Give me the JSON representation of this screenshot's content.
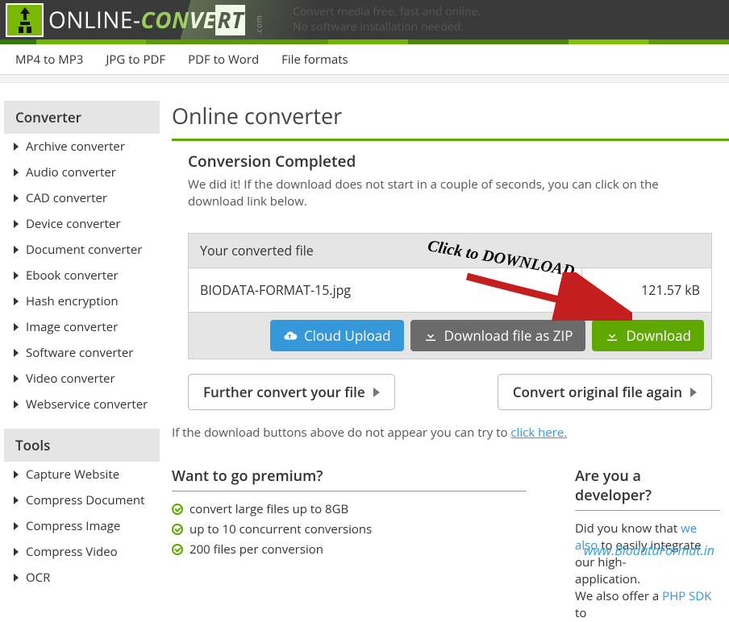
{
  "header": {
    "logo_online": "ONLINE",
    "logo_dash": "-",
    "logo_con": "CON",
    "logo_ve": "VE",
    "logo_rt": "RT",
    "logo_com": ".com",
    "tagline1": "Convert media free, fast and online.",
    "tagline2": "No software installation needed."
  },
  "topnav": {
    "items": [
      "MP4 to MP3",
      "JPG to PDF",
      "PDF to Word",
      "File formats"
    ]
  },
  "sidebar": {
    "converter_head": "Converter",
    "converter_items": [
      "Archive converter",
      "Audio converter",
      "CAD converter",
      "Device converter",
      "Document converter",
      "Ebook converter",
      "Hash encryption",
      "Image converter",
      "Software converter",
      "Video converter",
      "Webservice converter"
    ],
    "tools_head": "Tools",
    "tools_items": [
      "Capture Website",
      "Compress Document",
      "Compress Image",
      "Compress Video",
      "OCR"
    ]
  },
  "main": {
    "title": "Online converter",
    "status_head": "Conversion Completed",
    "status_text": "We did it! If the download does not start in a couple of seconds, you can click on the download link below.",
    "table_head": "Your converted file",
    "file_name": "BIODATA-FORMAT-15.jpg",
    "file_size": "121.57 kB",
    "click_annotation": "Click to DOWNLOAD",
    "btn_cloud": "Cloud Upload",
    "btn_zip": "Download file as ZIP",
    "btn_download": "Download",
    "btn_further": "Further convert your file",
    "btn_again": "Convert original file again",
    "note_pre": "If the download buttons above do not appear you can try to ",
    "note_link": "click here."
  },
  "premium": {
    "head": "Want to go premium?",
    "features": [
      "convert large files up to 8GB",
      "up to 10 concurrent conversions",
      "200 files per conversion"
    ]
  },
  "developer": {
    "head": "Are you a developer?",
    "text_pre": "Did you know that ",
    "text_link": "we also",
    "text_post1": " to easily integrate our high-",
    "text_post2": "application.",
    "text_post3": "We also offer a ",
    "text_link2": "PHP SDK",
    "text_post4": " to"
  },
  "watermark": "www.BiodataFormat.in"
}
